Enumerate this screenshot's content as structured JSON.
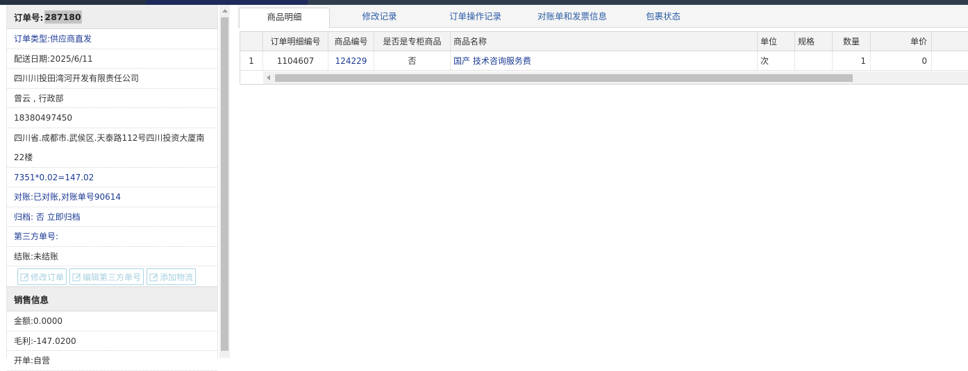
{
  "order": {
    "label": "订单号:",
    "number": "287180",
    "info_rows": [
      {
        "text": "订单类型:供应商直发",
        "blue": true
      },
      {
        "text": "配送日期:2025/6/11",
        "blue": false
      },
      {
        "text": "四川川投田湾河开发有限责任公司",
        "blue": false
      },
      {
        "text": "曾云 , 行政部",
        "blue": false
      },
      {
        "text": "18380497450",
        "blue": false
      },
      {
        "text": "四川省.成都市.武侯区.天泰路112号四川投资大厦南22楼",
        "blue": false,
        "tall": true
      },
      {
        "text": "7351*0.02=147.02",
        "blue": true
      },
      {
        "text": "对账:已对账,对账单号90614",
        "blue": true
      },
      {
        "text": "归档: 否 立即归档",
        "blue": true
      },
      {
        "text": "第三方单号:",
        "blue": true
      },
      {
        "text": "结账:未结账",
        "blue": false
      }
    ],
    "buttons": {
      "edit_order": "修改订单",
      "edit_third_party": "编辑第三方单号",
      "add_logistics": "添加物流"
    }
  },
  "sales": {
    "title": "销售信息",
    "rows": [
      "金额:0.0000",
      "毛利:-147.0200",
      "开单:自营"
    ]
  },
  "tabs": [
    "商品明细",
    "修改记录",
    "订单操作记录",
    "对账单和发票信息",
    "包裹状态"
  ],
  "active_tab": 0,
  "table": {
    "columns": [
      "",
      "订单明细编号",
      "商品编号",
      "是否是专柜商品",
      "商品名称",
      "单位",
      "规格",
      "数量",
      "单价"
    ],
    "rows": [
      [
        "1",
        "1104607",
        "124229",
        "否",
        "国产 技术咨询服务费",
        "次",
        "",
        "1",
        "0"
      ]
    ]
  },
  "colors": {
    "link": "#1b3a93",
    "tab_text": "#2a5ca6",
    "button_border": "#a7d3e3",
    "header_bg": "#eeeeee"
  }
}
